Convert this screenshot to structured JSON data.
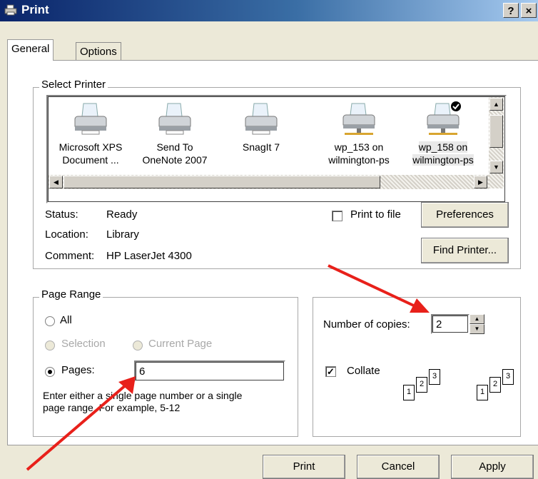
{
  "window": {
    "title": "Print",
    "help_label": "?",
    "close_label": "×"
  },
  "tabs": [
    {
      "label": "General",
      "active": true
    },
    {
      "label": "Options",
      "active": false
    }
  ],
  "select_printer": {
    "title": "Select Printer",
    "printers": [
      {
        "line1": "Microsoft XPS",
        "line2": "Document ...",
        "network": false,
        "default": false,
        "selected": false
      },
      {
        "line1": "Send To",
        "line2": "OneNote 2007",
        "network": false,
        "default": false,
        "selected": false
      },
      {
        "line1": "SnagIt 7",
        "line2": "",
        "network": false,
        "default": false,
        "selected": false
      },
      {
        "line1": "wp_153 on",
        "line2": "wilmington-ps",
        "network": true,
        "default": false,
        "selected": false
      },
      {
        "line1": "wp_158 on",
        "line2": "wilmington-ps",
        "network": true,
        "default": true,
        "selected": true
      }
    ],
    "status_label": "Status:",
    "status_value": "Ready",
    "location_label": "Location:",
    "location_value": "Library",
    "comment_label": "Comment:",
    "comment_value": "HP LaserJet 4300",
    "print_to_file_label": "Print to file",
    "print_to_file_checked": false,
    "preferences_label": "Preferences",
    "find_printer_label": "Find Printer..."
  },
  "page_range": {
    "title": "Page Range",
    "all_label": "All",
    "selection_label": "Selection",
    "current_page_label": "Current Page",
    "pages_label": "Pages:",
    "pages_value": "6",
    "selected_option": "Pages",
    "hint_line1": "Enter either a single page number or a single",
    "hint_line2": "page range.  For example, 5-12"
  },
  "copies": {
    "number_label": "Number of copies:",
    "number_value": "2",
    "collate_label": "Collate",
    "collate_checked": true,
    "collate_icon_pages": [
      "1",
      "2",
      "3"
    ]
  },
  "buttons": {
    "print": "Print",
    "cancel": "Cancel",
    "apply": "Apply"
  },
  "colors": {
    "title_bar": "#0a246a",
    "annotation_arrow": "#e8201a",
    "dialog_face": "#ece9d8"
  }
}
